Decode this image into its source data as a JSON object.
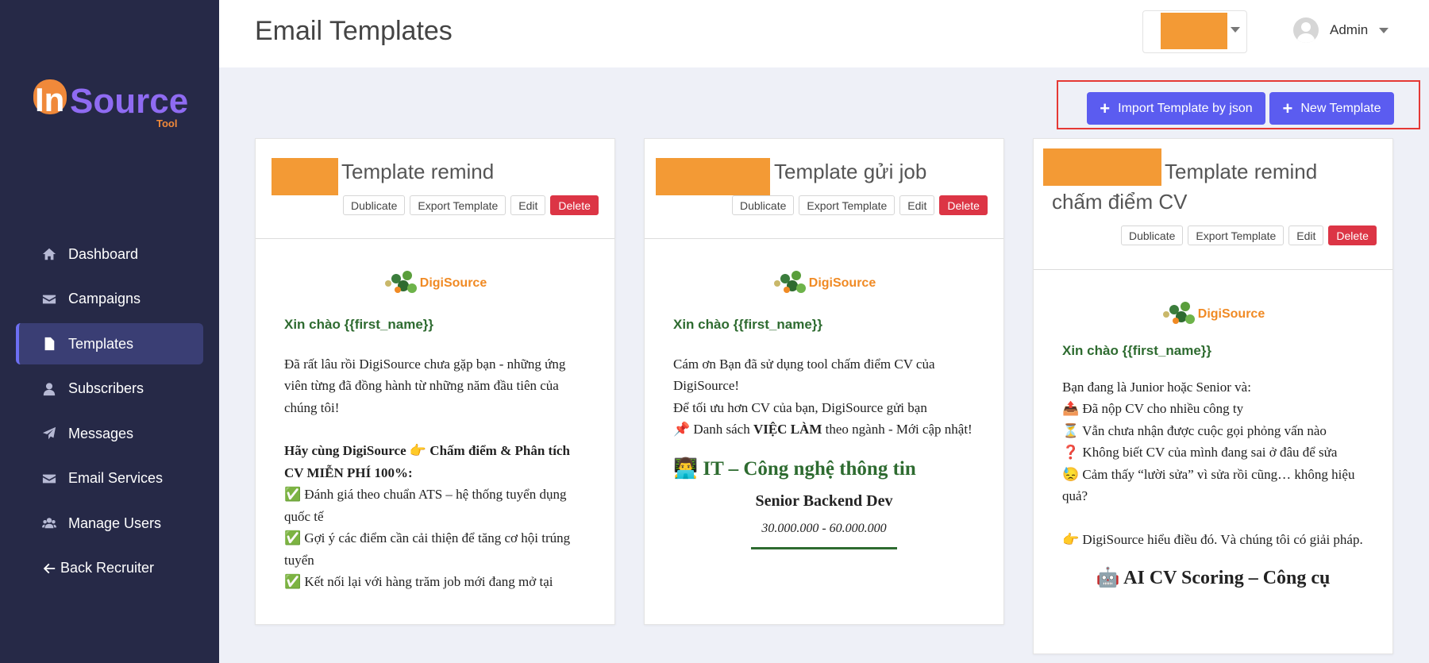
{
  "sidebar": {
    "logo": {
      "main_in": "In",
      "main_source": "Source",
      "sub": "Tool"
    },
    "items": [
      {
        "label": "Dashboard",
        "icon": "home-icon"
      },
      {
        "label": "Campaigns",
        "icon": "envelope-icon"
      },
      {
        "label": "Templates",
        "icon": "file-icon",
        "active": true
      },
      {
        "label": "Subscribers",
        "icon": "user-icon"
      },
      {
        "label": "Messages",
        "icon": "paper-plane-icon"
      },
      {
        "label": "Email Services",
        "icon": "envelope-icon"
      },
      {
        "label": "Manage Users",
        "icon": "users-icon"
      },
      {
        "label": "Back Recruiter",
        "icon": "arrow-left-icon"
      }
    ]
  },
  "header": {
    "title": "Email Templates",
    "user_name": "Admin"
  },
  "actions": {
    "import_label": "Import Template by json",
    "new_label": "New Template"
  },
  "card_buttons": {
    "duplicate": "Dublicate",
    "export": "Export Template",
    "edit": "Edit",
    "delete": "Delete"
  },
  "cards": [
    {
      "title": "Template remind",
      "brand": "DigiSource",
      "greeting": "Xin chào {{first_name}}",
      "intro": "Đã rất lâu rồi DigiSource chưa gặp bạn - những ứng viên từng đã đồng hành từ những năm đầu tiên của chúng tôi!",
      "cta": "Hãy cùng DigiSource 👉 Chấm điểm & Phân tích CV MIỄN PHÍ 100%:",
      "bullets": [
        "✅ Đánh giá theo chuẩn ATS – hệ thống tuyển dụng quốc tế",
        "✅ Gợi ý các điểm cần cải thiện để tăng cơ hội trúng tuyển",
        "✅ Kết nối lại với hàng trăm job mới đang mở tại"
      ]
    },
    {
      "title": "Template gửi job",
      "brand": "DigiSource",
      "greeting": "Xin chào {{first_name}}",
      "line1": "Cám ơn Bạn đã sử dụng tool chấm điểm CV của DigiSource!",
      "line2": "Để tối ưu hơn CV của bạn, DigiSource gửi bạn",
      "line3_pre": "📌 Danh sách ",
      "line3_bold": "VIỆC LÀM",
      "line3_post": " theo ngành - Mới cập nhật!",
      "section": "👨‍💻 IT – Công nghệ thông tin",
      "job_title": "Senior Backend Dev",
      "job_salary": "30.000.000 - 60.000.000"
    },
    {
      "title": "Template remind chấm điểm CV",
      "brand": "DigiSource",
      "greeting": "Xin chào {{first_name}}",
      "lines": [
        "Bạn đang là Junior hoặc Senior và:",
        "📤 Đã nộp CV cho nhiều công ty",
        "⏳ Vẫn chưa nhận được cuộc gọi phỏng vấn nào",
        "❓ Không biết CV của mình đang sai ở đâu để sửa",
        "😓 Cảm thấy “lười sửa” vì sửa rồi cũng… không hiệu quả?"
      ],
      "closing": "👉 DigiSource hiểu điều đó. Và chúng tôi có giải pháp.",
      "headline": "🤖 AI CV Scoring – Công cụ"
    }
  ],
  "colors": {
    "sidebar_bg": "#262947",
    "accent": "#5b5cf0",
    "danger": "#dc3545",
    "redacted": "#f39a35",
    "greeting_green": "#2e6b30",
    "brand_orange": "#f08a24"
  }
}
